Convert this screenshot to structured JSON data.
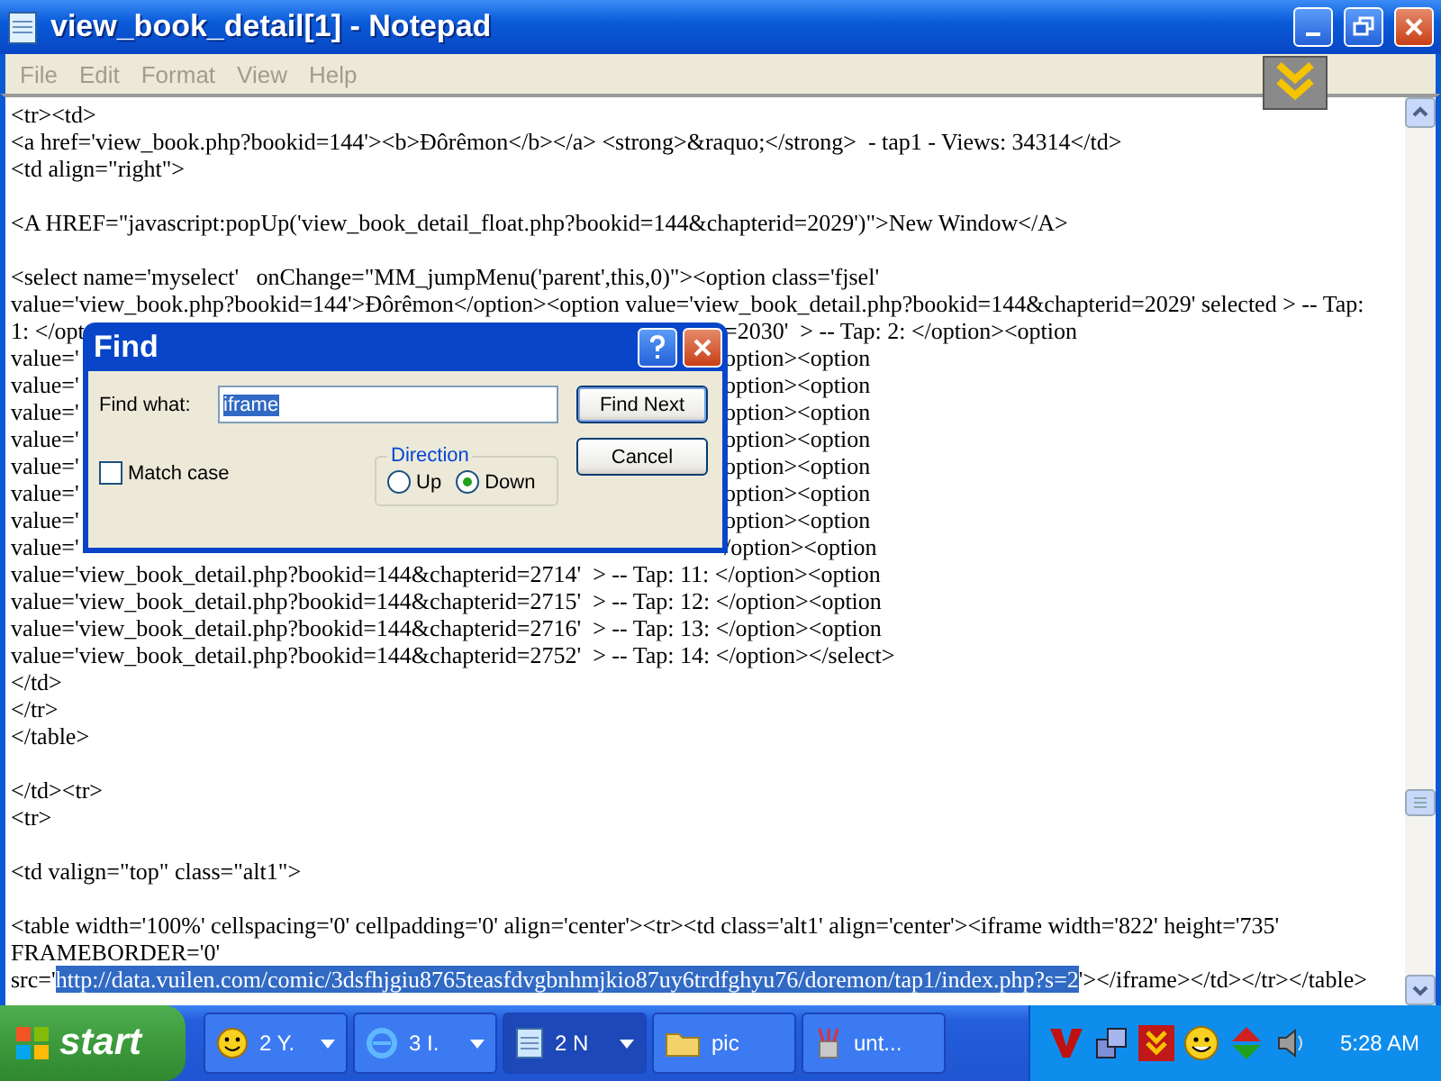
{
  "window": {
    "title": "view_book_detail[1] - Notepad"
  },
  "menu": [
    "File",
    "Edit",
    "Format",
    "View",
    "Help"
  ],
  "editor": {
    "lines": [
      {
        "kind": "text",
        "segments": [
          {
            "text": "<tr><td>",
            "highlighted": false
          }
        ]
      },
      {
        "kind": "text",
        "segments": [
          {
            "text": "<a href='view_book.php?bookid=144'><b>Đôrêmon</b></a> <strong>&raquo;</strong>  - tap1 - Views: 34314</td>",
            "highlighted": false
          }
        ]
      },
      {
        "kind": "text",
        "segments": [
          {
            "text": "<td align=\"right\">",
            "highlighted": false
          }
        ]
      },
      {
        "kind": "blank"
      },
      {
        "kind": "text",
        "segments": [
          {
            "text": "<A HREF=\"javascript:popUp('view_book_detail_float.php?bookid=144&chapterid=2029')\">New Window</A>",
            "highlighted": false
          }
        ]
      },
      {
        "kind": "blank"
      },
      {
        "kind": "text",
        "segments": [
          {
            "text": "<select name='myselect'   onChange=\"MM_jumpMenu('parent',this,0)\"><option class='fjsel'",
            "highlighted": false
          }
        ]
      },
      {
        "kind": "text",
        "segments": [
          {
            "text": "value='view_book.php?bookid=144'>Đôrêmon</option><option value='view_book_detail.php?bookid=144&chapterid=2029' selected > -- Tap:",
            "highlighted": false
          }
        ]
      },
      {
        "kind": "covered",
        "left": "1: </opt",
        "right": "=2030'  > -- Tap: 2: </option><option"
      },
      {
        "kind": "covered",
        "left": "value='",
        "right": "option><option"
      },
      {
        "kind": "covered",
        "left": "value='",
        "right": "option><option"
      },
      {
        "kind": "covered",
        "left": "value='",
        "right": "option><option"
      },
      {
        "kind": "covered",
        "left": "value='",
        "right": "option><option"
      },
      {
        "kind": "covered",
        "left": "value='",
        "right": "option><option"
      },
      {
        "kind": "covered",
        "left": "value='",
        "right": "option><option"
      },
      {
        "kind": "covered",
        "left": "value='",
        "right": "option><option"
      },
      {
        "kind": "covered",
        "left": "value='",
        "right": "/option><option"
      },
      {
        "kind": "text",
        "segments": [
          {
            "text": "value='view_book_detail.php?bookid=144&chapterid=2714'  > -- Tap: 11: </option><option",
            "highlighted": false
          }
        ]
      },
      {
        "kind": "text",
        "segments": [
          {
            "text": "value='view_book_detail.php?bookid=144&chapterid=2715'  > -- Tap: 12: </option><option",
            "highlighted": false
          }
        ]
      },
      {
        "kind": "text",
        "segments": [
          {
            "text": "value='view_book_detail.php?bookid=144&chapterid=2716'  > -- Tap: 13: </option><option",
            "highlighted": false
          }
        ]
      },
      {
        "kind": "text",
        "segments": [
          {
            "text": "value='view_book_detail.php?bookid=144&chapterid=2752'  > -- Tap: 14: </option></select>",
            "highlighted": false
          }
        ]
      },
      {
        "kind": "text",
        "segments": [
          {
            "text": "</td>",
            "highlighted": false
          }
        ]
      },
      {
        "kind": "text",
        "segments": [
          {
            "text": "</tr>",
            "highlighted": false
          }
        ]
      },
      {
        "kind": "text",
        "segments": [
          {
            "text": "</table>",
            "highlighted": false
          }
        ]
      },
      {
        "kind": "blank"
      },
      {
        "kind": "text",
        "segments": [
          {
            "text": "</td><tr>",
            "highlighted": false
          }
        ]
      },
      {
        "kind": "text",
        "segments": [
          {
            "text": "<tr>",
            "highlighted": false
          }
        ]
      },
      {
        "kind": "blank"
      },
      {
        "kind": "text",
        "segments": [
          {
            "text": "<td valign=\"top\" class=\"alt1\">",
            "highlighted": false
          }
        ]
      },
      {
        "kind": "blank"
      },
      {
        "kind": "text",
        "segments": [
          {
            "text": "<table width='100%' cellspacing='0' cellpadding='0' align='center'><tr><td class='alt1' align='center'><iframe width='822' height='735'",
            "highlighted": false
          }
        ]
      },
      {
        "kind": "text",
        "segments": [
          {
            "text": "FRAMEBORDER='0'",
            "highlighted": false
          }
        ]
      },
      {
        "kind": "text",
        "segments": [
          {
            "text": "src='",
            "highlighted": false
          },
          {
            "text": "http://data.vuilen.com/comic/3dsfhjgiu8765teasfdvgbnhmjkio87uy6trdfghyu76/doremon/tap1/index.php?s=2",
            "highlighted": true
          },
          {
            "text": "'></iframe></td></tr></table>",
            "highlighted": false
          }
        ]
      }
    ]
  },
  "find_dialog": {
    "title": "Find",
    "find_what_label": "Find what:",
    "find_what_value": "iframe",
    "value_selected": true,
    "find_next": "Find Next",
    "cancel": "Cancel",
    "direction_label": "Direction",
    "directions": [
      {
        "label": "Up",
        "selected": false
      },
      {
        "label": "Down",
        "selected": true
      }
    ],
    "match_case": {
      "label": "Match case",
      "checked": false
    }
  },
  "taskbar": {
    "start": "start",
    "tasks": [
      {
        "label": "2 Y.",
        "grouped": true,
        "selected": false
      },
      {
        "label": "3 I.",
        "grouped": true,
        "selected": false
      },
      {
        "label": "2 N",
        "grouped": true,
        "selected": true
      },
      {
        "label": "pic",
        "grouped": false,
        "selected": false
      },
      {
        "label": "unt...",
        "grouped": false,
        "selected": false
      }
    ],
    "clock": "5:28 AM"
  }
}
